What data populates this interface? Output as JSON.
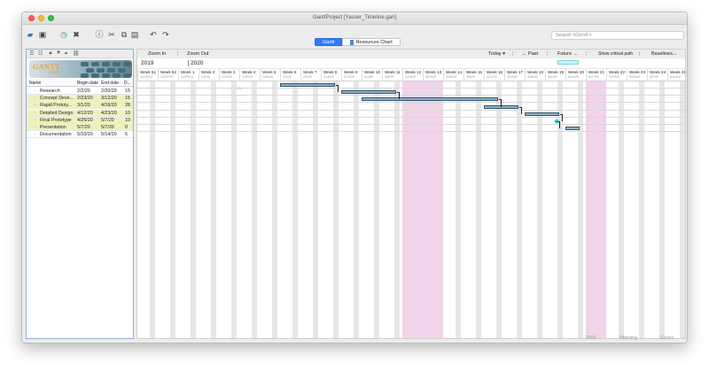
{
  "window": {
    "title": "GanttProject [Yasser_Timeline.gan]"
  },
  "toolbar": {
    "icons": [
      "open-folder-icon",
      "save-icon",
      "history-icon",
      "delete-icon",
      "info-icon",
      "cut-icon",
      "copy-icon",
      "paste-icon",
      "undo-icon",
      "redo-icon"
    ],
    "search_placeholder": "Search <Ctrl+F>"
  },
  "view_tabs": {
    "gantt": "Gantt",
    "resources": "Resources Chart"
  },
  "logo": {
    "text": "GANTT",
    "sub": "project"
  },
  "tasks": {
    "headers": {
      "name": "Name",
      "begin": "Begin date",
      "end": "End date",
      "duration": "D..."
    },
    "rows": [
      {
        "name": "Research",
        "begin": "2/2/20",
        "end": "2/20/20",
        "duration": "15"
      },
      {
        "name": "Concept Deve...",
        "begin": "2/23/20",
        "end": "3/12/20",
        "duration": "15"
      },
      {
        "name": "Rapid Prototy...",
        "begin": "3/1/20",
        "end": "4/16/20",
        "duration": "28"
      },
      {
        "name": "Detailed Design",
        "begin": "4/12/20",
        "end": "4/23/20",
        "duration": "10"
      },
      {
        "name": "Final Prototype",
        "begin": "4/26/20",
        "end": "5/7/20",
        "duration": "10"
      },
      {
        "name": "Presentation",
        "begin": "5/7/20",
        "end": "5/7/20",
        "duration": "0"
      },
      {
        "name": "Documentation",
        "begin": "5/10/20",
        "end": "5/14/20",
        "duration": "5"
      }
    ]
  },
  "gantt_toolbar": {
    "zoom_in": "Zoom In",
    "zoom_out": "Zoom Out",
    "today": "Today ▾",
    "past": "← Past",
    "future": "Future →",
    "critical": "Show critical path",
    "baselines": "Baselines..."
  },
  "years": [
    "2019",
    "2020"
  ],
  "weeks": [
    {
      "label": "Week 51",
      "date": "12/15/19"
    },
    {
      "label": "Week 52",
      "date": "12/22/19"
    },
    {
      "label": "Week 1",
      "date": "12/29/19"
    },
    {
      "label": "Week 2",
      "date": "1/5/20"
    },
    {
      "label": "Week 3",
      "date": "1/12/20"
    },
    {
      "label": "Week 4",
      "date": "1/19/20"
    },
    {
      "label": "Week 5",
      "date": "1/26/20"
    },
    {
      "label": "Week 6",
      "date": "2/2/20"
    },
    {
      "label": "Week 7",
      "date": "2/9/20"
    },
    {
      "label": "Week 8",
      "date": "2/16/20"
    },
    {
      "label": "Week 9",
      "date": "2/23/20"
    },
    {
      "label": "Week 10",
      "date": "3/1/20"
    },
    {
      "label": "Week 11",
      "date": "3/8/20"
    },
    {
      "label": "Week 12",
      "date": "3/15/20"
    },
    {
      "label": "Week 13",
      "date": "3/22/20"
    },
    {
      "label": "Week 14",
      "date": "3/29/20"
    },
    {
      "label": "Week 15",
      "date": "4/5/20"
    },
    {
      "label": "Week 16",
      "date": "4/12/20"
    },
    {
      "label": "Week 17",
      "date": "4/19/20"
    },
    {
      "label": "Week 18",
      "date": "4/26/20"
    },
    {
      "label": "Week 19",
      "date": "5/3/20"
    },
    {
      "label": "Week 20",
      "date": "5/10/20"
    },
    {
      "label": "Week 21",
      "date": "5/17/20"
    },
    {
      "label": "Week 22",
      "date": "5/24/20"
    },
    {
      "label": "Week 23",
      "date": "5/31/20"
    },
    {
      "label": "Week 24",
      "date": "6/7/20"
    },
    {
      "label": "Week 25",
      "date": "6/14/20"
    }
  ],
  "today_marker": "1/26/20",
  "highlight_weeks": [
    "Week 12",
    "Week 13",
    "Week 21"
  ],
  "status": {
    "rss": "RSS",
    "warning": "Warning",
    "errors": "Errors"
  },
  "colors": {
    "bar": "#8fb1c6",
    "bar_border": "#31566c",
    "weekend": "#e6e6e6",
    "holiday": "#f1d3ea",
    "selected_row": "#eef1bf",
    "accent": "#2e7cf6"
  }
}
